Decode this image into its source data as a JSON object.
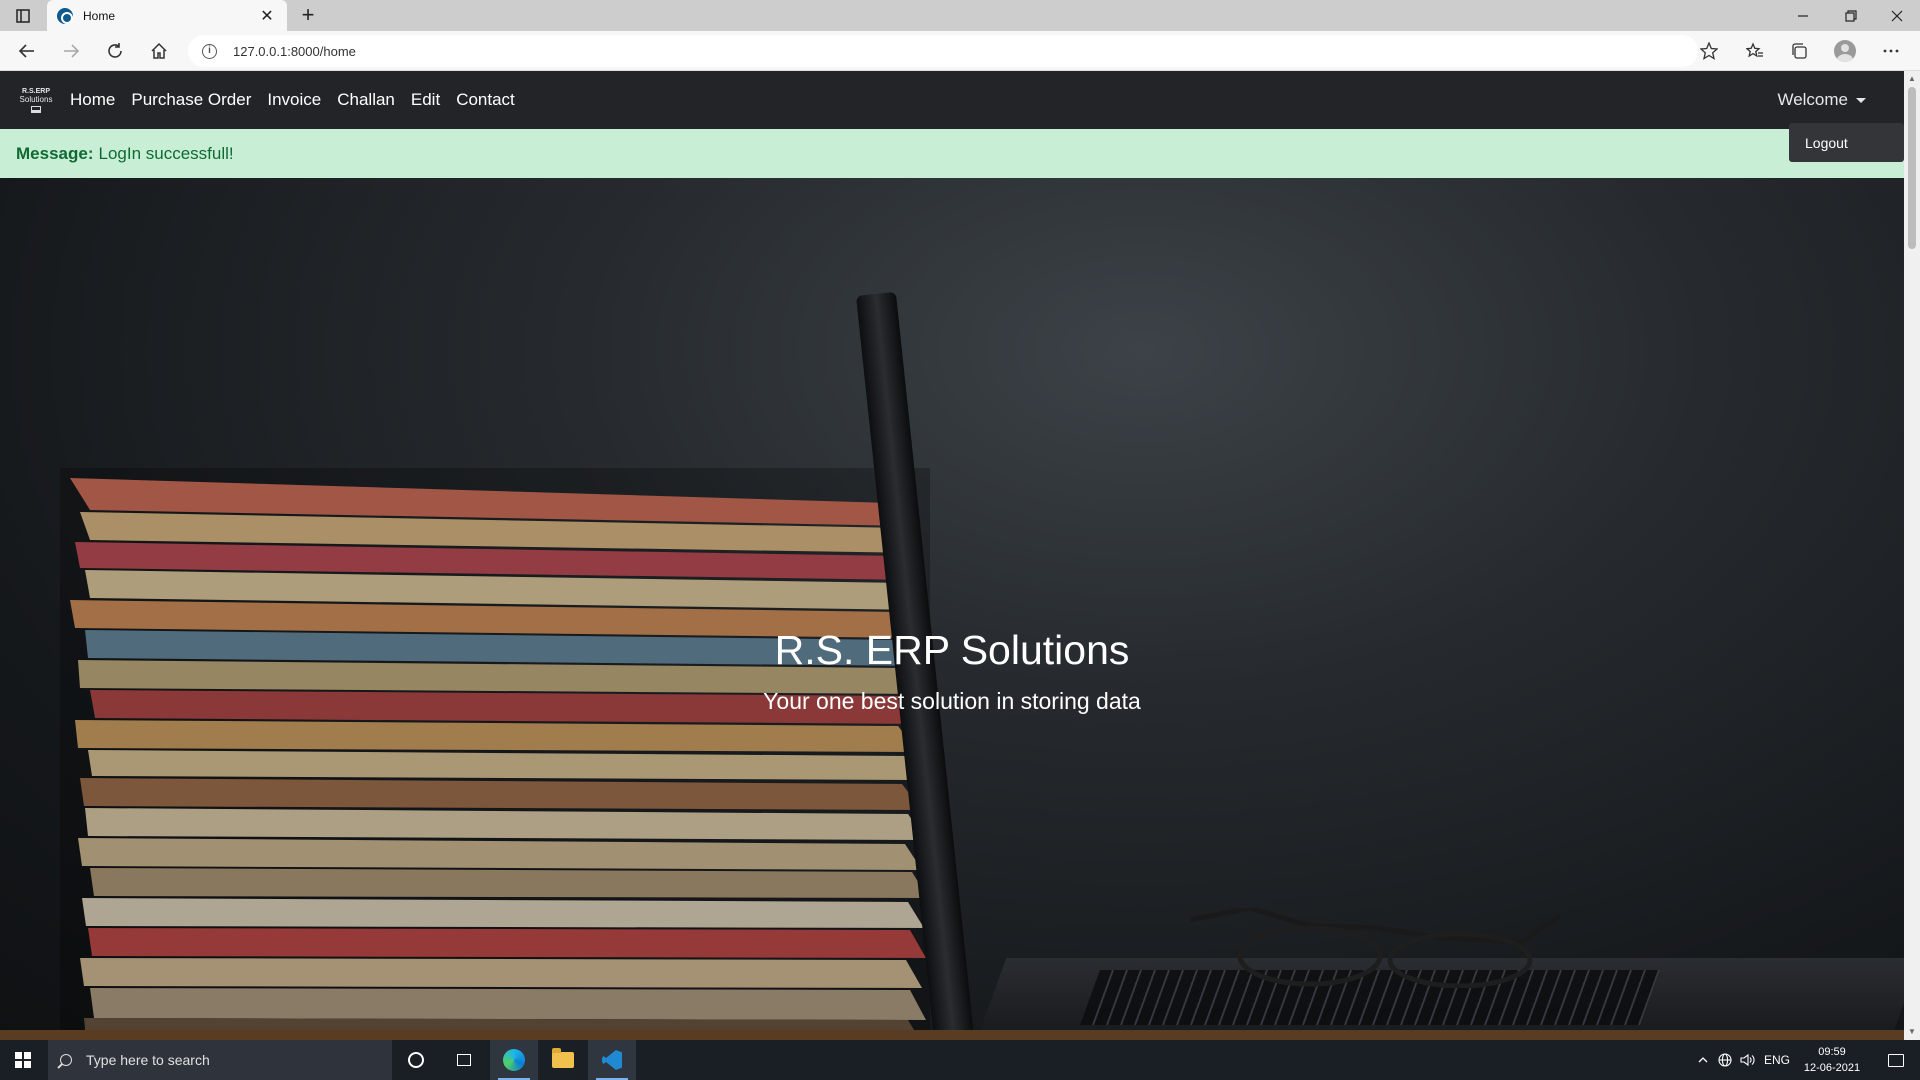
{
  "browser": {
    "tab_title": "Home",
    "new_tab": "+",
    "close_tab": "✕",
    "url": "127.0.0.1:8000/home",
    "url_host": "127.0.0.1",
    "url_rest": ":8000/home"
  },
  "site": {
    "brand_line1": "R.S.ERP",
    "brand_line2": "Solutions",
    "nav": [
      "Home",
      "Purchase Order",
      "Invoice",
      "Challan",
      "Edit",
      "Contact"
    ],
    "welcome": "Welcome",
    "dropdown_item": "Logout",
    "alert_label": "Message:",
    "alert_text": "LogIn successfull!",
    "hero_title": "R.S. ERP Solutions",
    "hero_subtitle": "Your one best solution in storing data"
  },
  "taskbar": {
    "search_placeholder": "Type here to search",
    "language": "ENG",
    "time": "09:59",
    "date": "12-06-2021"
  },
  "icons": {
    "back": "back-arrow-icon",
    "forward": "forward-arrow-icon",
    "refresh": "refresh-icon",
    "home": "home-icon",
    "favorite": "star-add-icon",
    "favorites": "favorites-icon",
    "collections": "collections-icon",
    "profile": "profile-icon",
    "more": "more-icon"
  },
  "colors": {
    "site_nav_bg": "#222427",
    "alert_bg": "#c9eed6",
    "alert_text": "#0f6b32",
    "dropdown_bg": "#333538",
    "taskbar_bg": "#1a1f26"
  }
}
